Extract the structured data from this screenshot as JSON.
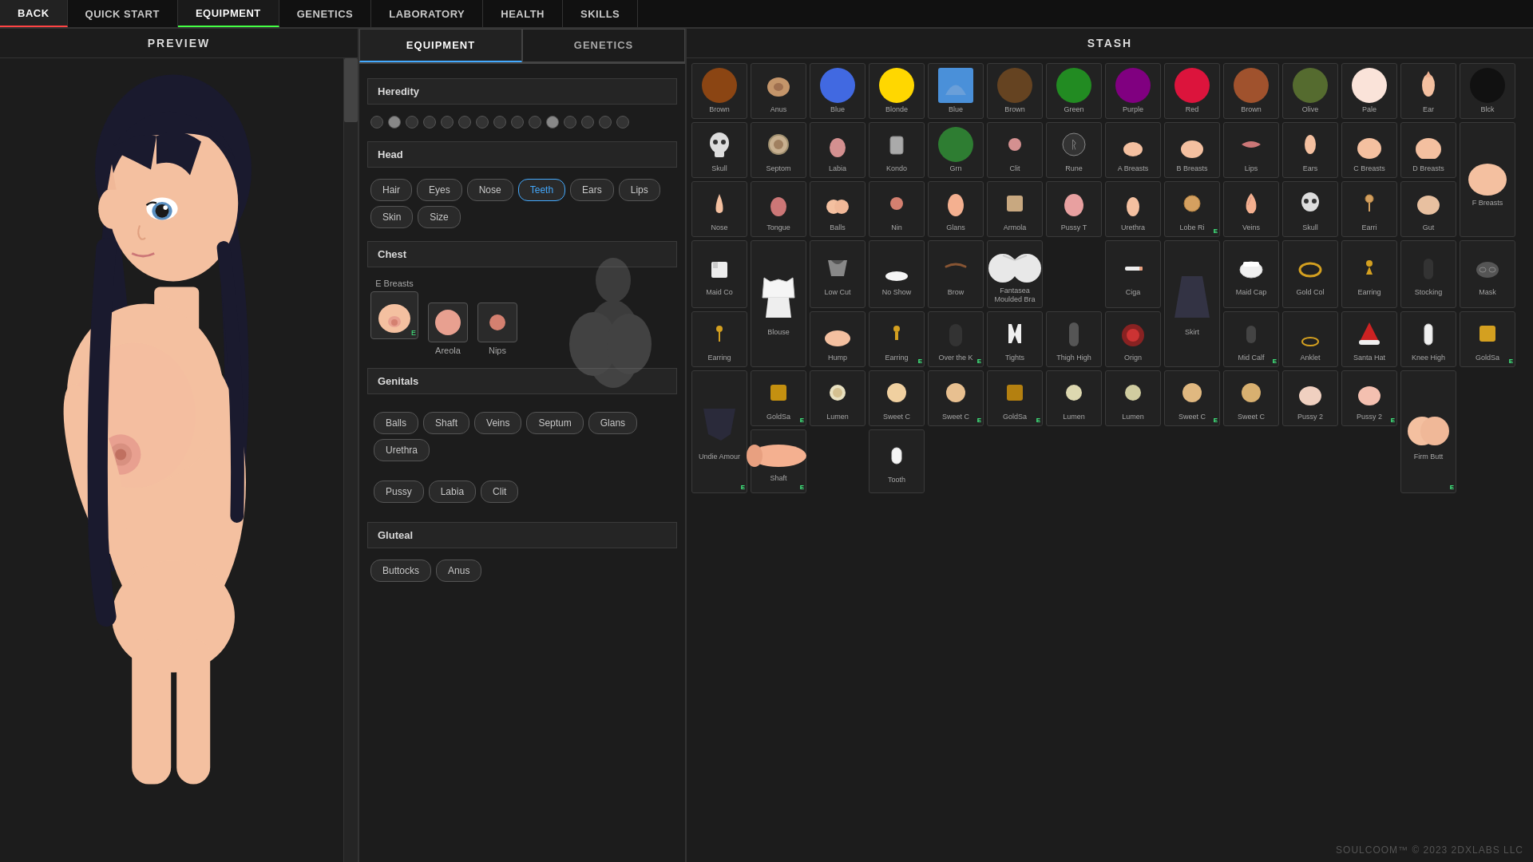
{
  "nav": {
    "back_label": "BACK",
    "items": [
      {
        "label": "QUICK START",
        "active": false
      },
      {
        "label": "EQUIPMENT",
        "active": false
      },
      {
        "label": "GENETICS",
        "active": false
      },
      {
        "label": "LABORATORY",
        "active": false
      },
      {
        "label": "HEALTH",
        "active": false
      },
      {
        "label": "SKILLS",
        "active": false
      }
    ]
  },
  "preview": {
    "title": "PREVIEW"
  },
  "equipment": {
    "tab_equipment": "EQUIPMENT",
    "tab_genetics": "GENETICS",
    "sections": {
      "heredity": "Heredity",
      "head": "Head",
      "chest": "Chest",
      "genitals": "Genitals",
      "gluteal": "Gluteal"
    },
    "head_buttons": [
      "Hair",
      "Eyes",
      "Nose",
      "Teeth",
      "Ears",
      "Lips",
      "Skin",
      "Size"
    ],
    "chest_items": [
      {
        "label": "E Breasts",
        "badge": "E"
      },
      {
        "label": "Areola"
      },
      {
        "label": "Nips"
      }
    ],
    "genitals_buttons_top": [
      "Shaft",
      "Veins",
      "Septum",
      "Glans",
      "Urethra"
    ],
    "genitals_buttons_mid": [
      "Balls"
    ],
    "genitals_buttons_bot": [
      "Pussy",
      "Labia",
      "Clit"
    ],
    "gluteal_buttons": [
      "Buttocks",
      "Anus"
    ]
  },
  "stash": {
    "title": "Stash",
    "items": [
      {
        "label": "Brown",
        "type": "swatch",
        "color": "#8B5513"
      },
      {
        "label": "Anus",
        "type": "body"
      },
      {
        "label": "Blue",
        "type": "swatch",
        "color": "#4169E1"
      },
      {
        "label": "Blonde",
        "type": "swatch",
        "color": "#FFD700"
      },
      {
        "label": "Blue",
        "type": "swatch",
        "color": "#6495ED"
      },
      {
        "label": "Brown",
        "type": "swatch",
        "color": "#654321"
      },
      {
        "label": "Green",
        "type": "swatch",
        "color": "#228B22"
      },
      {
        "label": "Purple",
        "type": "swatch",
        "color": "#800080"
      },
      {
        "label": "Red",
        "type": "swatch",
        "color": "#DC143C"
      },
      {
        "label": "Brown",
        "type": "swatch",
        "color": "#A0522D"
      },
      {
        "label": "Olive",
        "type": "swatch",
        "color": "#556B2F"
      },
      {
        "label": "Pale",
        "type": "swatch",
        "color": "#FAE3D9"
      },
      {
        "label": "Ear",
        "type": "body"
      },
      {
        "label": "Blck",
        "type": "swatch",
        "color": "#111111"
      },
      {
        "label": "Skull",
        "type": "item"
      },
      {
        "label": "Septom",
        "type": "body"
      },
      {
        "label": "Labia",
        "type": "body"
      },
      {
        "label": "Kondo",
        "type": "item"
      },
      {
        "label": "Grn",
        "type": "swatch",
        "color": "#2e7d32"
      },
      {
        "label": "Clit",
        "type": "body"
      },
      {
        "label": "Rune",
        "type": "item"
      },
      {
        "label": "A Breasts",
        "type": "body"
      },
      {
        "label": "B Breasts",
        "type": "body"
      },
      {
        "label": "Lips",
        "type": "body"
      },
      {
        "label": "Ears",
        "type": "body"
      },
      {
        "label": "C Breasts",
        "type": "body"
      },
      {
        "label": "D Breasts",
        "type": "body"
      },
      {
        "label": "F Breasts",
        "type": "body"
      },
      {
        "label": "Nose",
        "type": "body"
      },
      {
        "label": "Tongue",
        "type": "body"
      },
      {
        "label": "Balls",
        "type": "body"
      },
      {
        "label": "Nin",
        "type": "body"
      },
      {
        "label": "Glans",
        "type": "body"
      },
      {
        "label": "Armola",
        "type": "item"
      },
      {
        "label": "Pussy T",
        "type": "body"
      },
      {
        "label": "Urethra",
        "type": "body"
      },
      {
        "label": "Lobe Ri",
        "type": "body",
        "badge": "E"
      },
      {
        "label": "Veins",
        "type": "body"
      },
      {
        "label": "Skull",
        "type": "item"
      },
      {
        "label": "Earri",
        "type": "item"
      },
      {
        "label": "Gut",
        "type": "item"
      },
      {
        "label": "Maid Co",
        "type": "item"
      },
      {
        "label": "Blouse",
        "type": "clothing"
      },
      {
        "label": "Low Cut",
        "type": "clothing"
      },
      {
        "label": "No Show",
        "type": "item"
      },
      {
        "label": "Brow",
        "type": "item"
      },
      {
        "label": "Fantasea Moulded Bra",
        "type": "clothing"
      },
      {
        "label": "Ciga",
        "type": "item"
      },
      {
        "label": "Skirt",
        "type": "clothing"
      },
      {
        "label": "Maid Cap",
        "type": "clothing"
      },
      {
        "label": "Gold Col",
        "type": "item"
      },
      {
        "label": "Earring",
        "type": "item"
      },
      {
        "label": "Stocking",
        "type": "clothing"
      },
      {
        "label": "Mask",
        "type": "item"
      },
      {
        "label": "Earring",
        "type": "item"
      },
      {
        "label": "Hump",
        "type": "body"
      },
      {
        "label": "Earring",
        "type": "item"
      },
      {
        "label": "Over the K",
        "type": "clothing"
      },
      {
        "label": "Tights",
        "type": "clothing"
      },
      {
        "label": "Thigh High",
        "type": "clothing"
      },
      {
        "label": "Orign",
        "type": "item"
      },
      {
        "label": "Mid Calf",
        "type": "clothing"
      },
      {
        "label": "Anklet",
        "type": "item"
      },
      {
        "label": "Santa Hat",
        "type": "clothing"
      },
      {
        "label": "Knee High",
        "type": "clothing"
      },
      {
        "label": "GoldSa",
        "type": "item"
      },
      {
        "label": "Undie Amour",
        "type": "clothing"
      },
      {
        "label": "GoldSa",
        "type": "item"
      },
      {
        "label": "Lumen",
        "type": "item"
      },
      {
        "label": "Sweet C",
        "type": "item"
      },
      {
        "label": "Sweet C",
        "type": "item"
      },
      {
        "label": "GoldSa",
        "type": "item"
      },
      {
        "label": "Lumen",
        "type": "item"
      },
      {
        "label": "Lumen",
        "type": "item"
      },
      {
        "label": "Sweet C",
        "type": "item"
      },
      {
        "label": "Sweet C",
        "type": "item"
      },
      {
        "label": "Pussy 2",
        "type": "body"
      },
      {
        "label": "Pussy 2",
        "type": "body"
      },
      {
        "label": "Firm Butt",
        "type": "body"
      },
      {
        "label": "Shaft",
        "type": "body"
      },
      {
        "label": "Tooth",
        "type": "body"
      }
    ]
  },
  "footer": {
    "text": "SOULCOOM™ © 2023 2DXLABS LLC"
  }
}
